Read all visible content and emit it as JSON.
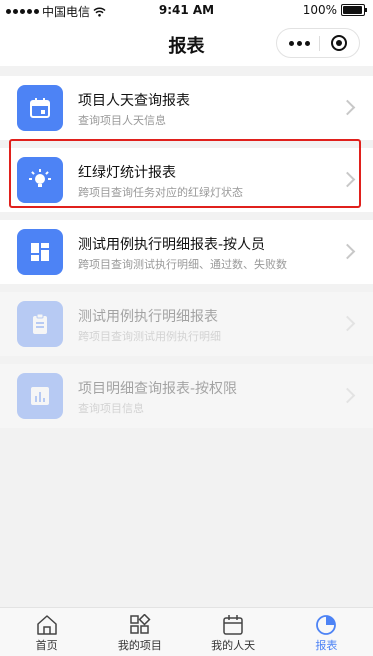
{
  "statusbar": {
    "carrier": "中国电信",
    "time": "9:41 AM",
    "battery": "100%",
    "battery_level": 1.0
  },
  "navbar": {
    "title": "报表"
  },
  "colors": {
    "accent": "#4d83f5",
    "highlight": "#e0201c"
  },
  "reports": [
    {
      "title": "项目人天查询报表",
      "subtitle": "查询项目人天信息",
      "icon": "calendar-icon"
    },
    {
      "title": "红绿灯统计报表",
      "subtitle": "跨项目查询任务对应的红绿灯状态",
      "icon": "lightbulb-icon"
    },
    {
      "title": "测试用例执行明细报表-按人员",
      "subtitle": "跨项目查询测试执行明细、通过数、失败数",
      "icon": "dashboard-icon"
    },
    {
      "title": "测试用例执行明细报表",
      "subtitle": "跨项目查询测试用例执行明细",
      "icon": "clipboard-icon"
    },
    {
      "title": "项目明细查询报表-按权限",
      "subtitle": "查询项目信息",
      "icon": "bar-chart-icon"
    }
  ],
  "tabs": [
    {
      "label": "首页",
      "icon": "home-icon",
      "active": false
    },
    {
      "label": "我的项目",
      "icon": "grid-icon",
      "active": false
    },
    {
      "label": "我的人天",
      "icon": "calendar-icon",
      "active": false
    },
    {
      "label": "报表",
      "icon": "pie-chart-icon",
      "active": true
    }
  ]
}
